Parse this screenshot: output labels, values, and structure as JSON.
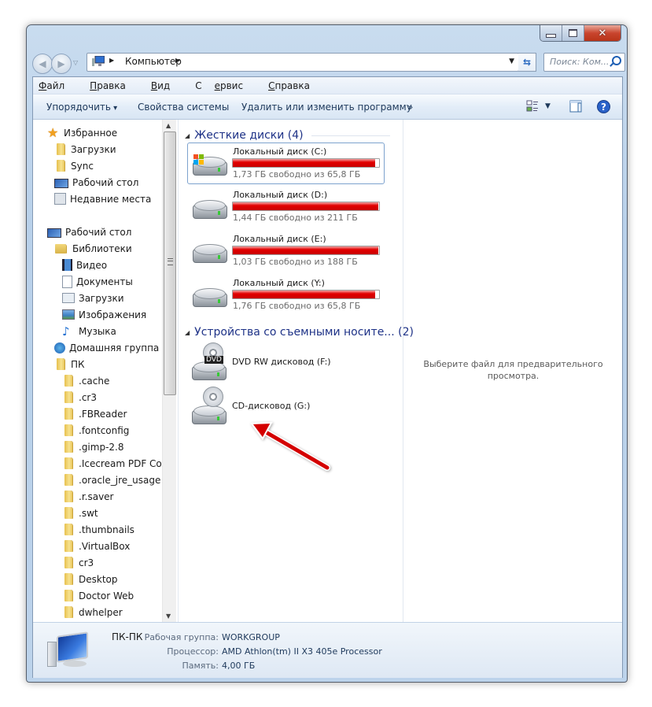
{
  "window": {
    "caption_buttons": {
      "minimize": "minimize",
      "maximize": "maximize",
      "close": "close"
    }
  },
  "address": {
    "crumbs": [
      "Компьютер"
    ],
    "search_placeholder": "Поиск: Ком..."
  },
  "menu": {
    "items": [
      {
        "label": "Файл",
        "accel": "Ф"
      },
      {
        "label": "Правка",
        "accel": "П"
      },
      {
        "label": "Вид",
        "accel": "В"
      },
      {
        "label": "Сервис",
        "accel": "е"
      },
      {
        "label": "Справка",
        "accel": "С"
      }
    ]
  },
  "toolbar": {
    "organize": "Упорядочить",
    "system_properties": "Свойства системы",
    "uninstall": "Удалить или изменить программу",
    "more": "»"
  },
  "nav": {
    "favorites": {
      "label": "Избранное",
      "items": [
        "Загрузки",
        "Sync",
        "Рабочий стол",
        "Недавние места"
      ]
    },
    "desktop": "Рабочий стол",
    "libraries": {
      "label": "Библиотеки",
      "items": [
        "Видео",
        "Документы",
        "Загрузки",
        "Изображения",
        "Музыка"
      ]
    },
    "homegroup": "Домашняя группа",
    "pc": {
      "label": "ПК",
      "items": [
        ".cache",
        ".cr3",
        ".FBReader",
        ".fontconfig",
        ".gimp-2.8",
        ".Icecream PDF Con",
        ".oracle_jre_usage",
        ".r.saver",
        ".swt",
        ".thumbnails",
        ".VirtualBox",
        "cr3",
        "Desktop",
        "Doctor Web",
        "dwhelper"
      ]
    }
  },
  "content": {
    "hard_disks_header": "Жесткие диски (4)",
    "drives": [
      {
        "name": "Локальный диск (C:)",
        "free": "1,73 ГБ свободно из 65,8 ГБ",
        "used_fraction": 0.974,
        "selected": true
      },
      {
        "name": "Локальный диск (D:)",
        "free": "1,44 ГБ свободно из 211 ГБ",
        "used_fraction": 0.993,
        "selected": false
      },
      {
        "name": "Локальный диск (E:)",
        "free": "1,03 ГБ свободно из 188 ГБ",
        "used_fraction": 0.995,
        "selected": false
      },
      {
        "name": "Локальный диск (Y:)",
        "free": "1,76 ГБ свободно из 65,8 ГБ",
        "used_fraction": 0.973,
        "selected": false
      }
    ],
    "removable_header": "Устройства со съемными носите... (2)",
    "removable": [
      {
        "name": "DVD RW дисковод (F:)",
        "badge": "DVD"
      },
      {
        "name": "CD-дисковод (G:)",
        "badge": ""
      }
    ],
    "bar_color": "#e30000"
  },
  "preview": {
    "message": "Выберите файл для предварительного просмотра."
  },
  "details": {
    "computer_name": "ПК-ПК",
    "rows": [
      {
        "label": "Рабочая группа:",
        "value": "WORKGROUP"
      },
      {
        "label": "Процессор:",
        "value": "AMD Athlon(tm) II X3 405e Processor"
      },
      {
        "label": "Память:",
        "value": "4,00 ГБ"
      }
    ]
  },
  "annotation": {
    "arrow_color": "#d40000",
    "points_to": "CD-дисковод (G:)"
  }
}
